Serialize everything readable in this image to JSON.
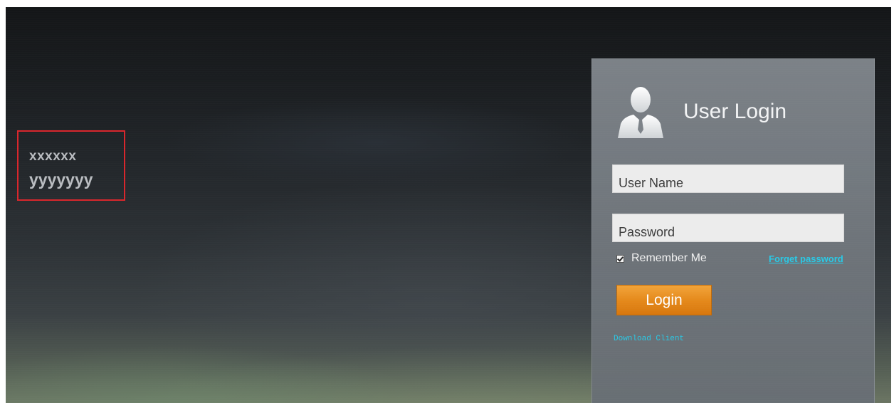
{
  "brand": {
    "line1": "xxxxxx",
    "line2": "yyyyyyy"
  },
  "login_panel": {
    "title": "User Login",
    "user_icon": "user-silhouette-icon",
    "username_placeholder": "User Name",
    "password_placeholder": "Password",
    "remember_me_label": "Remember Me",
    "remember_me_checked": true,
    "forget_password_label": "Forget password",
    "login_button_label": "Login",
    "download_client_label": "Download Client"
  },
  "colors": {
    "login_button": "#e58a1c",
    "link": "#29c9e6",
    "highlight_box": "#d9262c"
  }
}
